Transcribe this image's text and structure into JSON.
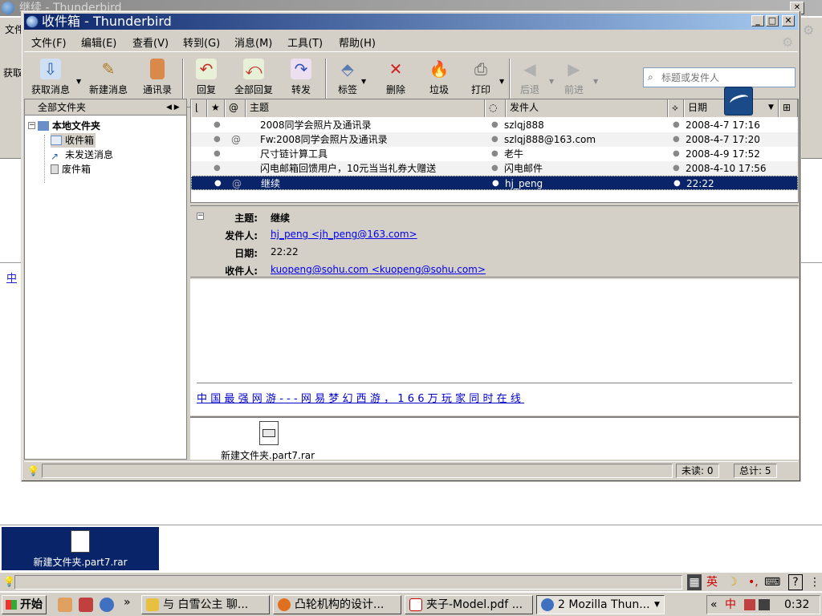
{
  "background_window": {
    "title": "继续 - Thunderbird",
    "menu_file": "文件",
    "toolbar_get": "获取",
    "link_text": "中",
    "attachment_label": "新建文件夹.part7.rar",
    "ime": {
      "lang": "英",
      "moon": "☽",
      "dot": "•,",
      "help": "?"
    }
  },
  "window": {
    "title": "收件箱 - Thunderbird",
    "controls": {
      "minimize": "_",
      "maximize": "□",
      "close": "✕"
    }
  },
  "menubar": [
    {
      "label": "文件(F)"
    },
    {
      "label": "编辑(E)"
    },
    {
      "label": "查看(V)"
    },
    {
      "label": "转到(G)"
    },
    {
      "label": "消息(M)"
    },
    {
      "label": "工具(T)"
    },
    {
      "label": "帮助(H)"
    }
  ],
  "toolbar": {
    "get_messages": "获取消息",
    "new_message": "新建消息",
    "address_book": "通讯录",
    "reply": "回复",
    "reply_all": "全部回复",
    "forward": "转发",
    "tag": "标签",
    "delete": "删除",
    "junk": "垃圾",
    "print": "打印",
    "back": "后退",
    "forward_nav": "前进",
    "search_placeholder": "标题或发件人"
  },
  "folders": {
    "header": "全部文件夹",
    "root": "本地文件夹",
    "items": [
      {
        "name": "收件箱",
        "icon": "inbox-icon",
        "selected": true
      },
      {
        "name": "未发送消息",
        "icon": "unsent-icon",
        "selected": false
      },
      {
        "name": "废件箱",
        "icon": "trash-icon",
        "selected": false
      }
    ]
  },
  "thread": {
    "columns": {
      "subject": "主题",
      "sender": "发件人",
      "date": "日期"
    },
    "rows": [
      {
        "subject": "2008同学会照片及通讯录",
        "sender": "szlqj888",
        "date": "2008-4-7 17:16",
        "attachment": "",
        "selected": false
      },
      {
        "subject": "Fw:2008同学会照片及通讯录",
        "sender": "szlqj888@163.com",
        "date": "2008-4-7 17:20",
        "attachment": "@",
        "selected": false
      },
      {
        "subject": "尺寸链计算工具",
        "sender": "老牛",
        "date": "2008-4-9 17:52",
        "attachment": "",
        "selected": false
      },
      {
        "subject": "闪电邮箱回馈用户，10元当当礼券大赠送",
        "sender": "闪电邮件",
        "date": "2008-4-10 17:56",
        "attachment": "",
        "selected": false
      },
      {
        "subject": "继续",
        "sender": "hj_peng",
        "date": "22:22",
        "attachment": "@",
        "selected": true
      }
    ]
  },
  "message": {
    "labels": {
      "subject": "主题:",
      "from": "发件人:",
      "date": "日期:",
      "to": "收件人:"
    },
    "subject": "继续",
    "from": "hj_peng <jh_peng@163.com>",
    "date": "22:22",
    "to": "kuopeng@sohu.com <kuopeng@sohu.com>",
    "body_promo": "中国最强网游---网易梦幻西游，166万玩家同时在线",
    "attachment": "新建文件夹.part7.rar"
  },
  "statusbar": {
    "unread": "未读: 0",
    "total": "总计: 5"
  },
  "taskbar": {
    "start": "开始",
    "chevron": "»",
    "tasks": [
      {
        "label": "与 白雪公主 聊...",
        "active": false
      },
      {
        "label": "凸轮机构的设计...",
        "active": false
      },
      {
        "label": "夹子-Model.pdf ...",
        "active": false
      },
      {
        "label": "2 Mozilla Thun...",
        "active": true
      }
    ],
    "tray_chevron": "«",
    "tray_ime": "中",
    "tray_clock": "0:32"
  }
}
